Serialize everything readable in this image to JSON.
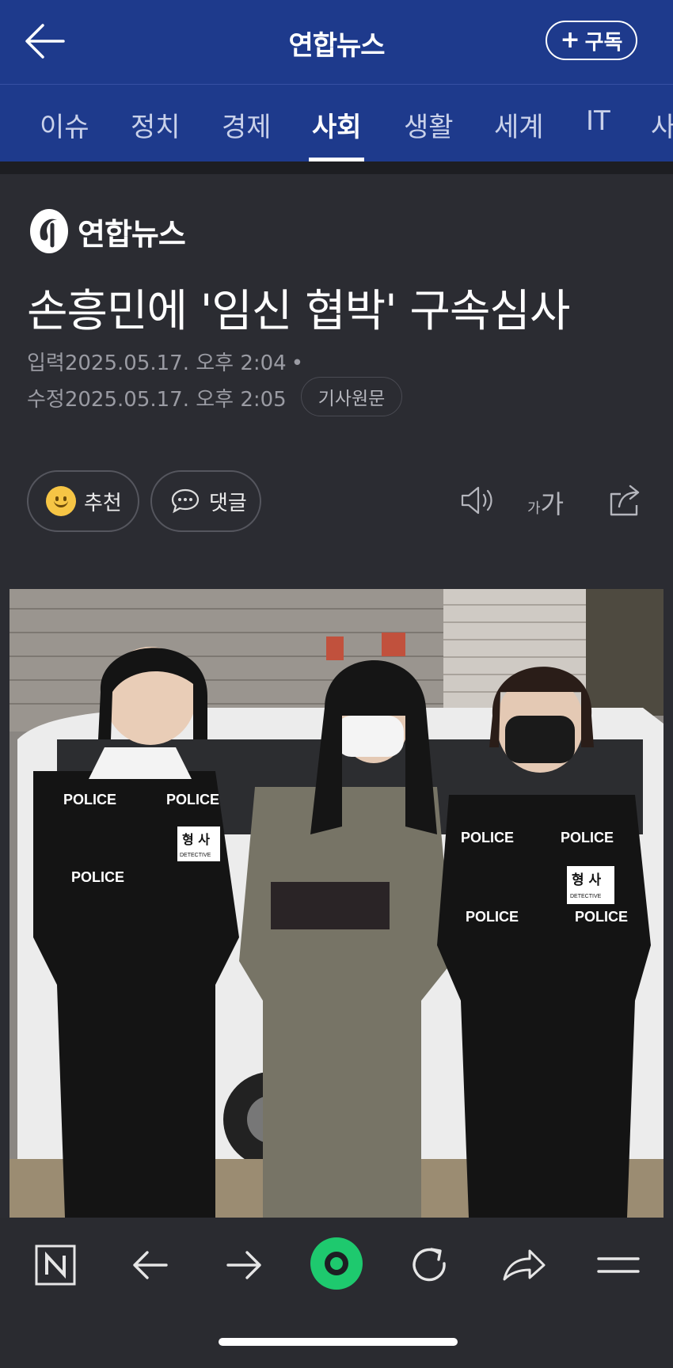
{
  "header": {
    "title": "연합뉴스",
    "subscribe_label": "구독"
  },
  "tabs": [
    {
      "label": "이슈",
      "active": false
    },
    {
      "label": "정치",
      "active": false
    },
    {
      "label": "경제",
      "active": false
    },
    {
      "label": "사회",
      "active": true
    },
    {
      "label": "생활",
      "active": false
    },
    {
      "label": "세계",
      "active": false
    },
    {
      "label": "IT",
      "active": false
    },
    {
      "label": "사",
      "active": false
    }
  ],
  "article": {
    "brand": "연합뉴스",
    "headline": "손흥민에 '임신 협박' 구속심사",
    "input_label": "입력",
    "input_time": "2025.05.17. 오후 2:04",
    "edit_label": "수정",
    "edit_time": "2025.05.17. 오후 2:05",
    "original_label": "기사원문"
  },
  "actions": {
    "recommend_label": "추천",
    "comment_label": "댓글",
    "font_small": "가",
    "font_large": "가"
  },
  "photo": {
    "vest_text": "POLICE",
    "badge_text": "형 사",
    "badge_sub": "DETECTIVE"
  },
  "colors": {
    "header_bg": "#1e3a8c",
    "page_bg": "#2b2c32",
    "accent_green": "#1ec96e"
  },
  "bottom_nav": [
    "naver-n-icon",
    "back-arrow-icon",
    "forward-arrow-icon",
    "green-dot-icon",
    "refresh-icon",
    "share-icon",
    "menu-icon"
  ]
}
